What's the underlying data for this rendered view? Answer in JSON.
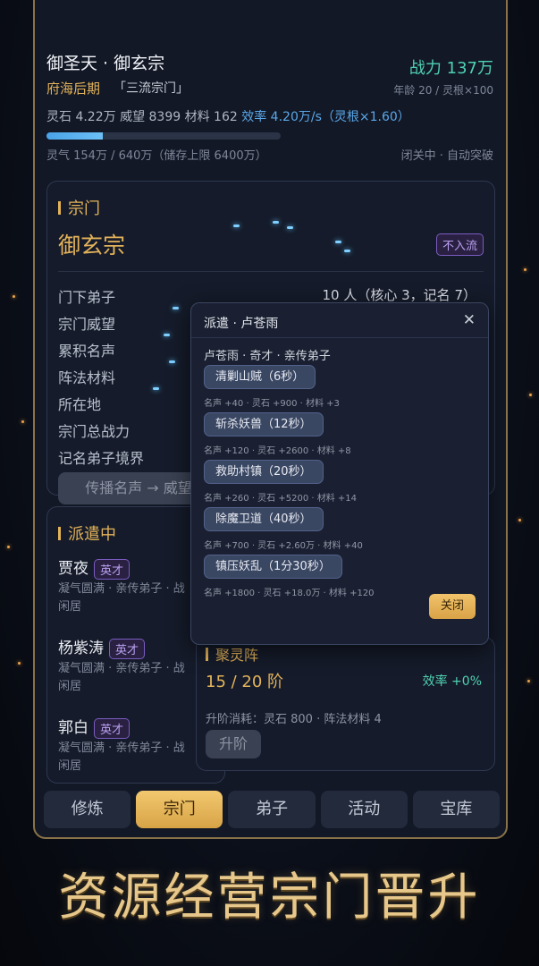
{
  "header": {
    "name": "御圣天 · 御玄宗",
    "power": "战力 137万",
    "realm": "府海后期",
    "sect_rank": "「三流宗门」",
    "age": "年龄 20 / 灵根×100",
    "resources": "灵石 4.22万   威望 8399   材料 162",
    "efficiency": "效率 4.20万/s（灵根×1.60）",
    "qi": "灵气 154万 / 640万（储存上限 6400万）",
    "qi_fraction": 0.24,
    "status": "闭关中 · 自动突破"
  },
  "sect_panel": {
    "title": "宗门",
    "sect_name": "御玄宗",
    "badge": "不入流",
    "rows": [
      {
        "label": "门下弟子",
        "value": "10 人（核心 3，记名 7）"
      },
      {
        "label": "宗门威望",
        "value": ""
      },
      {
        "label": "累积名声",
        "value": ""
      },
      {
        "label": "阵法材料",
        "value": ""
      },
      {
        "label": "所在地",
        "value": ""
      },
      {
        "label": "宗门总战力",
        "value": ""
      },
      {
        "label": "记名弟子境界",
        "value": ""
      }
    ],
    "action": "传播名声 → 威望"
  },
  "dispatch_panel": {
    "title": "派遣中",
    "disciples": [
      {
        "name": "贾夜",
        "tag": "英才",
        "line1": "凝气圆满 · 亲传弟子 · 战",
        "line2": "闲居"
      },
      {
        "name": "杨紫涛",
        "tag": "英才",
        "line1": "凝气圆满 · 亲传弟子 · 战",
        "line2": "闲居"
      },
      {
        "name": "郭白",
        "tag": "英才",
        "line1": "凝气圆满 · 亲传弟子 · 战",
        "line2": "闲居"
      }
    ]
  },
  "array_panel": {
    "title": "聚灵阵",
    "level": "15 / 20 阶",
    "efficiency": "效率 +0%",
    "cost": "升阶消耗：灵石 800 · 阵法材料 4",
    "upgrade": "升阶"
  },
  "dialog": {
    "title": "派遣 · 卢苍雨",
    "close": "✕",
    "disciple": "卢苍雨 · 奇才 · 亲传弟子",
    "tasks": [
      {
        "label": "清剿山贼（6秒）",
        "reward": "名声 +40 · 灵石 +900 · 材料 +3"
      },
      {
        "label": "斩杀妖兽（12秒）",
        "reward": "名声 +120 · 灵石 +2600 · 材料 +8"
      },
      {
        "label": "救助村镇（20秒）",
        "reward": "名声 +260 · 灵石 +5200 · 材料 +14"
      },
      {
        "label": "除魔卫道（40秒）",
        "reward": "名声 +700 · 灵石 +2.60万 · 材料 +40"
      },
      {
        "label": "镇压妖乱（1分30秒）",
        "reward": "名声 +1800 · 灵石 +18.0万 · 材料 +120"
      }
    ],
    "close_button": "关闭"
  },
  "tabs": [
    "修炼",
    "宗门",
    "弟子",
    "活动",
    "宝库"
  ],
  "active_tab": "宗门",
  "banner": "资源经营宗门晋升"
}
